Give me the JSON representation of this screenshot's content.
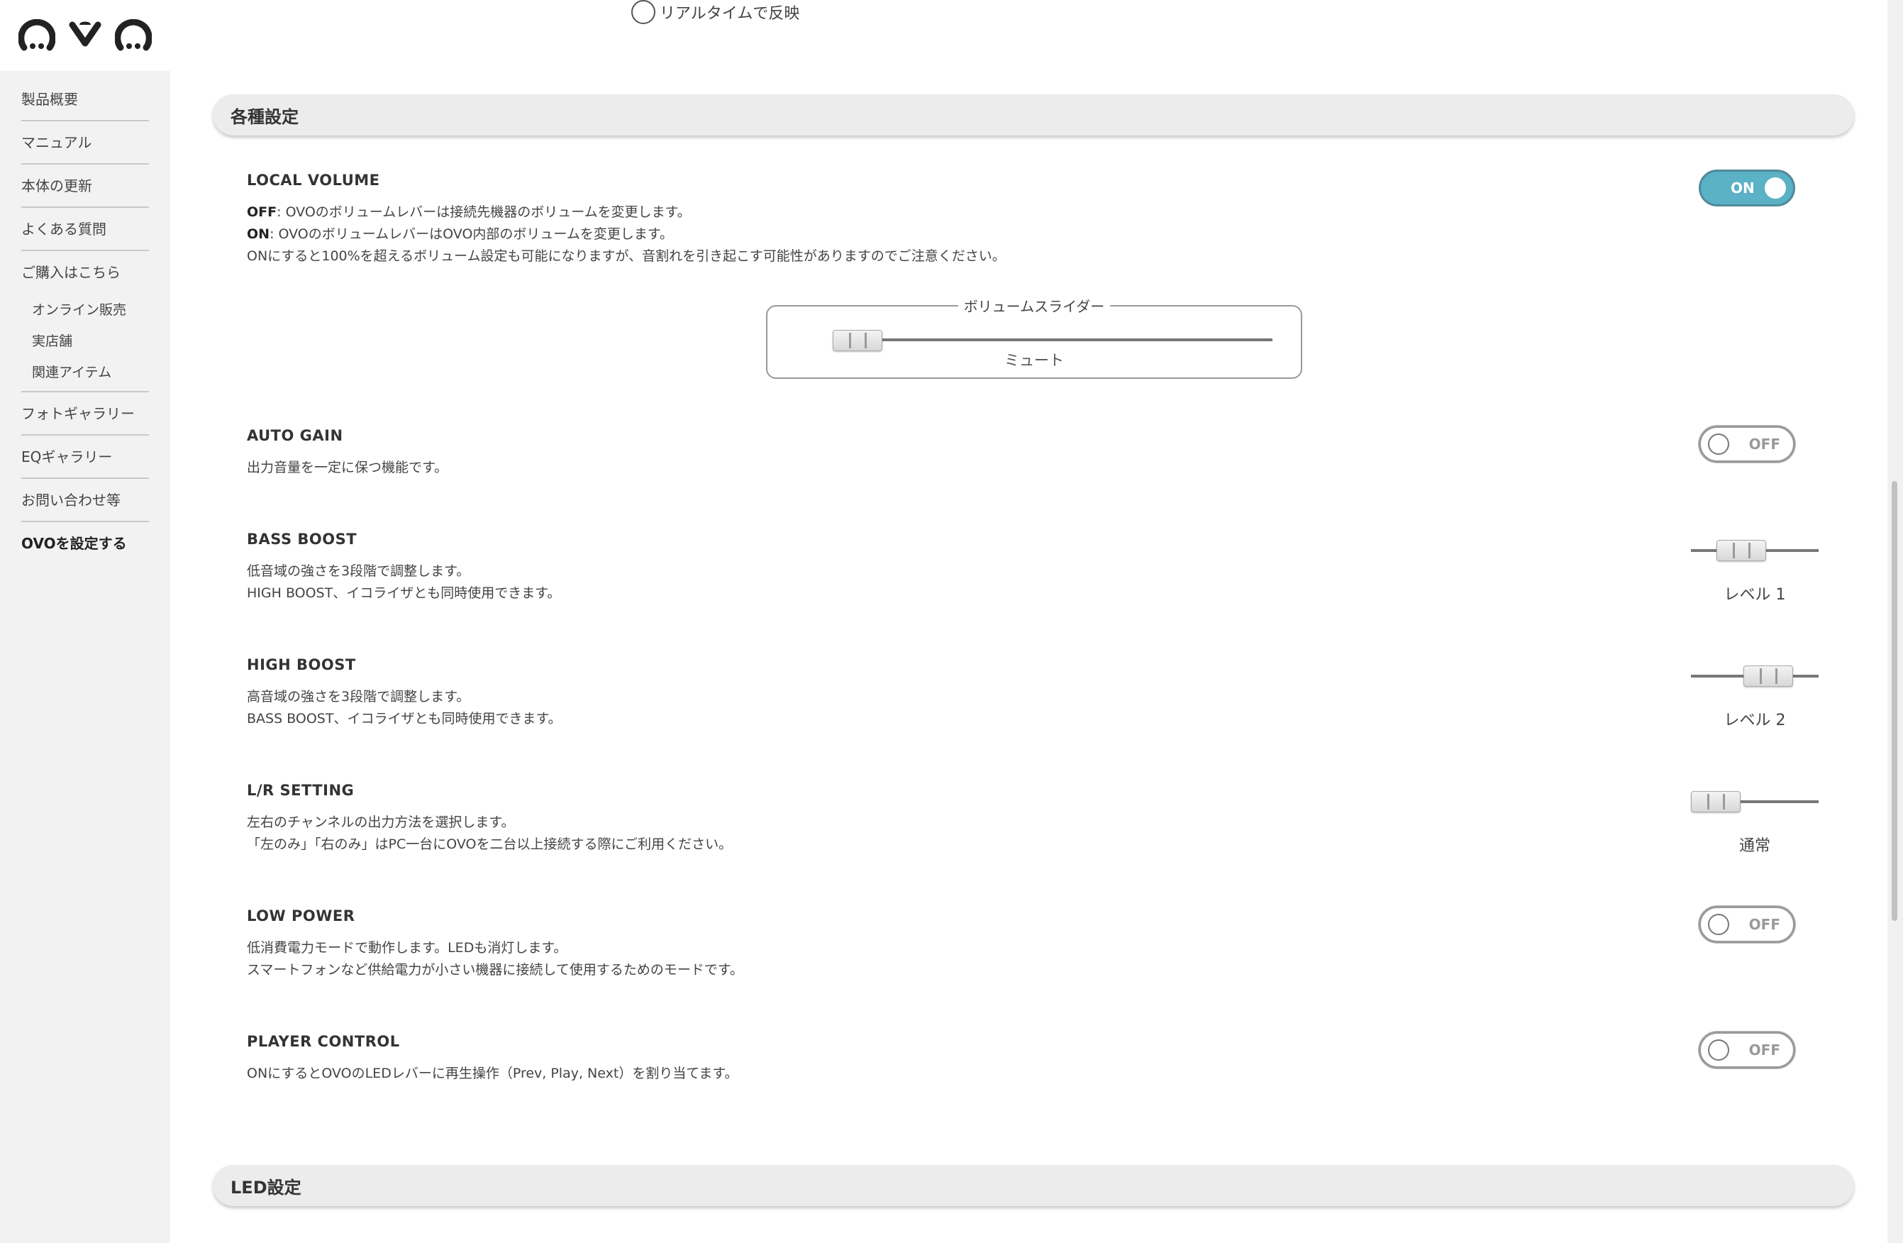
{
  "sidebar": {
    "items": [
      {
        "label": "製品概要"
      },
      {
        "label": "マニュアル"
      },
      {
        "label": "本体の更新"
      },
      {
        "label": "よくある質問"
      },
      {
        "label": "ご購入はこちら"
      }
    ],
    "sub_items": [
      {
        "label": "オンライン販売"
      },
      {
        "label": "実店舗"
      },
      {
        "label": "関連アイテム"
      }
    ],
    "items_after": [
      {
        "label": "フォトギャラリー"
      },
      {
        "label": "EQギャラリー"
      },
      {
        "label": "お問い合わせ等"
      },
      {
        "label": "OVOを設定する"
      }
    ]
  },
  "realtime": {
    "label": "リアルタイムで反映"
  },
  "sections": {
    "various": "各種設定",
    "led": "LED設定"
  },
  "local_volume": {
    "title": "LOCAL VOLUME",
    "off_key": "OFF",
    "off_text": ": OVOのボリュームレバーは接続先機器のボリュームを変更します。",
    "on_key": "ON",
    "on_text": ": OVOのボリュームレバーはOVO内部のボリュームを変更します。",
    "note": "ONにすると100%を超えるボリューム設定も可能になりますが、音割れを引き起こす可能性がありますのでご注意ください。",
    "toggle": "ON",
    "state": "on",
    "slider_legend": "ボリュームスライダー",
    "slider_value": "ミュート"
  },
  "auto_gain": {
    "title": "AUTO GAIN",
    "desc": "出力音量を一定に保つ機能です。",
    "toggle": "OFF",
    "state": "off"
  },
  "bass_boost": {
    "title": "BASS BOOST",
    "desc1": "低音域の強さを3段階で調整します。",
    "desc2": "HIGH BOOST、イコライザとも同時使用できます。",
    "value": "レベル 1",
    "level": 1
  },
  "high_boost": {
    "title": "HIGH BOOST",
    "desc1": "高音域の強さを3段階で調整します。",
    "desc2": "BASS BOOST、イコライザとも同時使用できます。",
    "value": "レベル 2",
    "level": 2
  },
  "lr_setting": {
    "title": "L/R SETTING",
    "desc1": "左右のチャンネルの出力方法を選択します。",
    "desc2": "「左のみ」「右のみ」はPC一台にOVOを二台以上接続する際にご利用ください。",
    "value": "通常",
    "level": 0
  },
  "low_power": {
    "title": "LOW POWER",
    "desc1": "低消費電力モードで動作します。LEDも消灯します。",
    "desc2": "スマートフォンなど供給電力が小さい機器に接続して使用するためのモードです。",
    "toggle": "OFF",
    "state": "off"
  },
  "player_control": {
    "title": "PLAYER CONTROL",
    "desc": "ONにするとOVOのLEDレバーに再生操作（Prev, Play, Next）を割り当てます。",
    "toggle": "OFF",
    "state": "off"
  },
  "colors": {
    "toggle_on": "#5bb1c6",
    "sidebar_bg": "#f2f2f2",
    "section_bg": "#ececec"
  },
  "icons": {
    "logo": "ovo-logo"
  }
}
